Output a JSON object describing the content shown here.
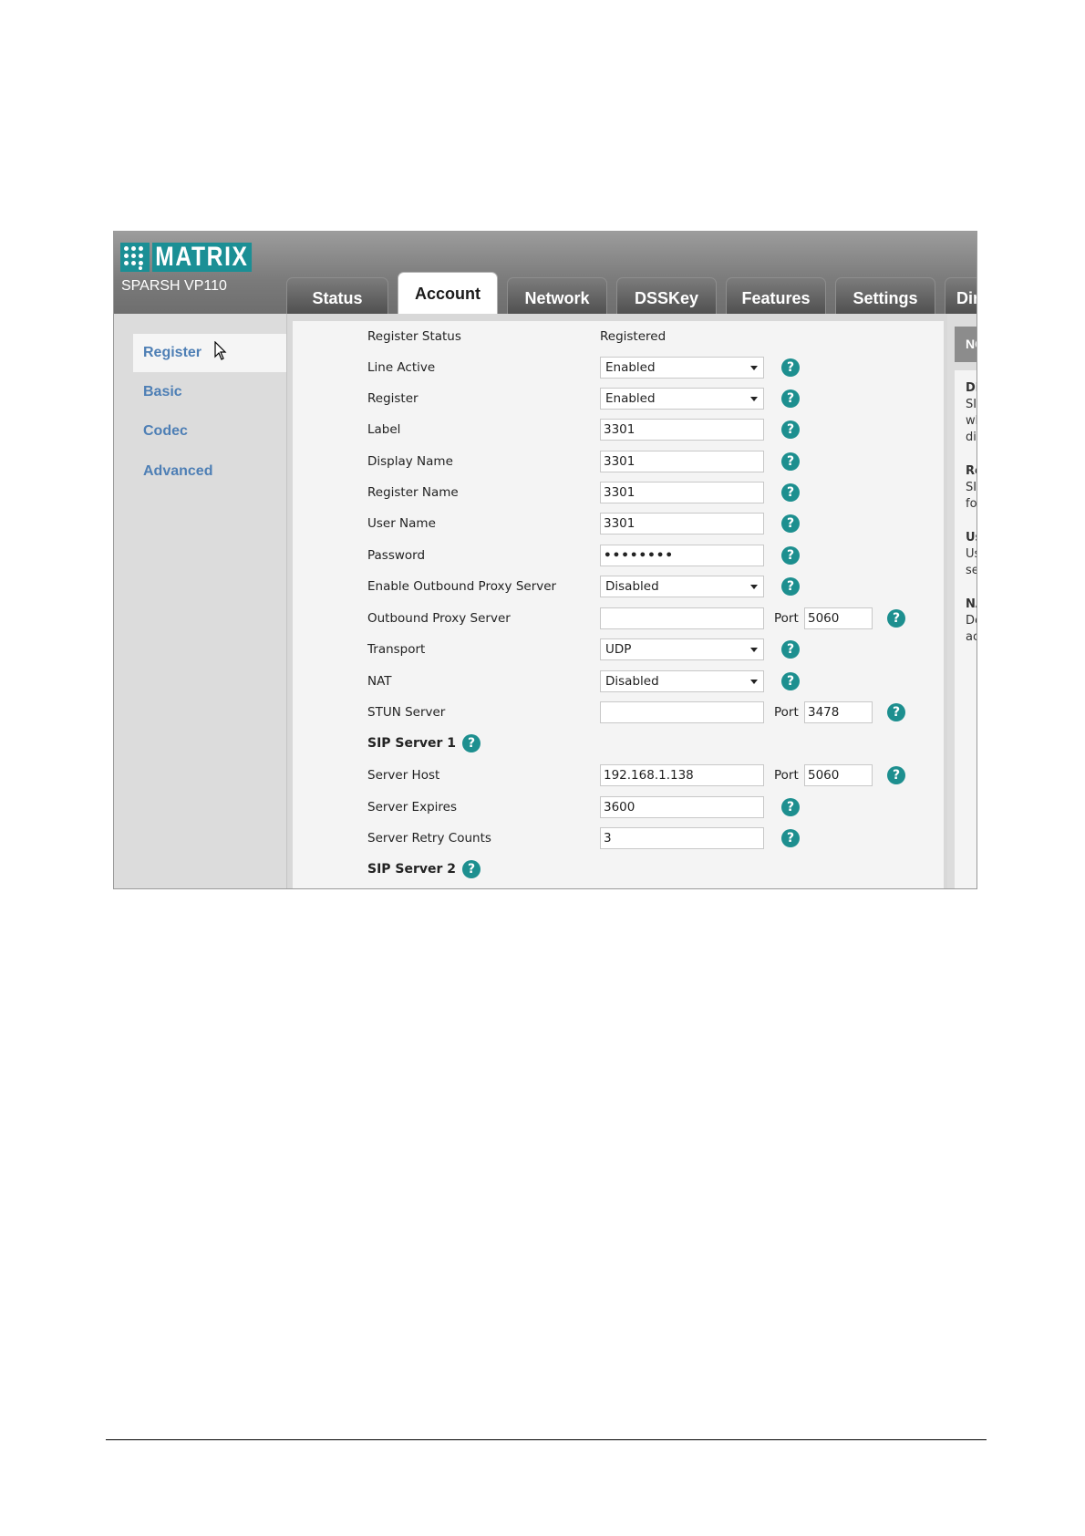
{
  "header": {
    "brand": "MATRIX",
    "model": "SPARSH VP110",
    "tabs": [
      {
        "label": "Status"
      },
      {
        "label": "Account"
      },
      {
        "label": "Network"
      },
      {
        "label": "DSSKey"
      },
      {
        "label": "Features"
      },
      {
        "label": "Settings"
      },
      {
        "label": "Dir"
      }
    ],
    "active_tab": "Account"
  },
  "leftnav": {
    "items": [
      {
        "label": "Register"
      },
      {
        "label": "Basic"
      },
      {
        "label": "Codec"
      },
      {
        "label": "Advanced"
      }
    ],
    "active": "Register"
  },
  "form": {
    "register_status": {
      "label": "Register Status",
      "value": "Registered"
    },
    "line_active": {
      "label": "Line Active",
      "value": "Enabled"
    },
    "register": {
      "label": "Register",
      "value": "Enabled"
    },
    "label": {
      "label": "Label",
      "value": "3301"
    },
    "display_name": {
      "label": "Display Name",
      "value": "3301"
    },
    "register_name": {
      "label": "Register Name",
      "value": "3301"
    },
    "user_name": {
      "label": "User Name",
      "value": "3301"
    },
    "password": {
      "label": "Password",
      "value": "••••••••"
    },
    "enable_outbound_proxy": {
      "label": "Enable Outbound Proxy Server",
      "value": "Disabled"
    },
    "outbound_proxy": {
      "label": "Outbound Proxy Server",
      "value": "",
      "port_label": "Port",
      "port": "5060"
    },
    "transport": {
      "label": "Transport",
      "value": "UDP"
    },
    "nat": {
      "label": "NAT",
      "value": "Disabled"
    },
    "stun_server": {
      "label": "STUN Server",
      "value": "",
      "port_label": "Port",
      "port": "3478"
    },
    "sip_server_1": {
      "label": "SIP Server 1"
    },
    "server_host": {
      "label": "Server Host",
      "value": "192.168.1.138",
      "port_label": "Port",
      "port": "5060"
    },
    "server_expires": {
      "label": "Server Expires",
      "value": "3600"
    },
    "server_retry_counts": {
      "label": "Server Retry Counts",
      "value": "3"
    },
    "sip_server_2": {
      "label": "SIP Server 2"
    },
    "help_glyph": "?"
  },
  "notes": {
    "heading": "NC",
    "lines": [
      "Dis",
      "SIP",
      "wh",
      "disp",
      "Re",
      "SIP",
      "for",
      "Use",
      "Use",
      "ser",
      "NA",
      "Def",
      "act"
    ]
  },
  "colors": {
    "brand_teal": "#1b8f95",
    "help_icon": "#1d8f8f",
    "nav_link": "#4e7fb5"
  }
}
